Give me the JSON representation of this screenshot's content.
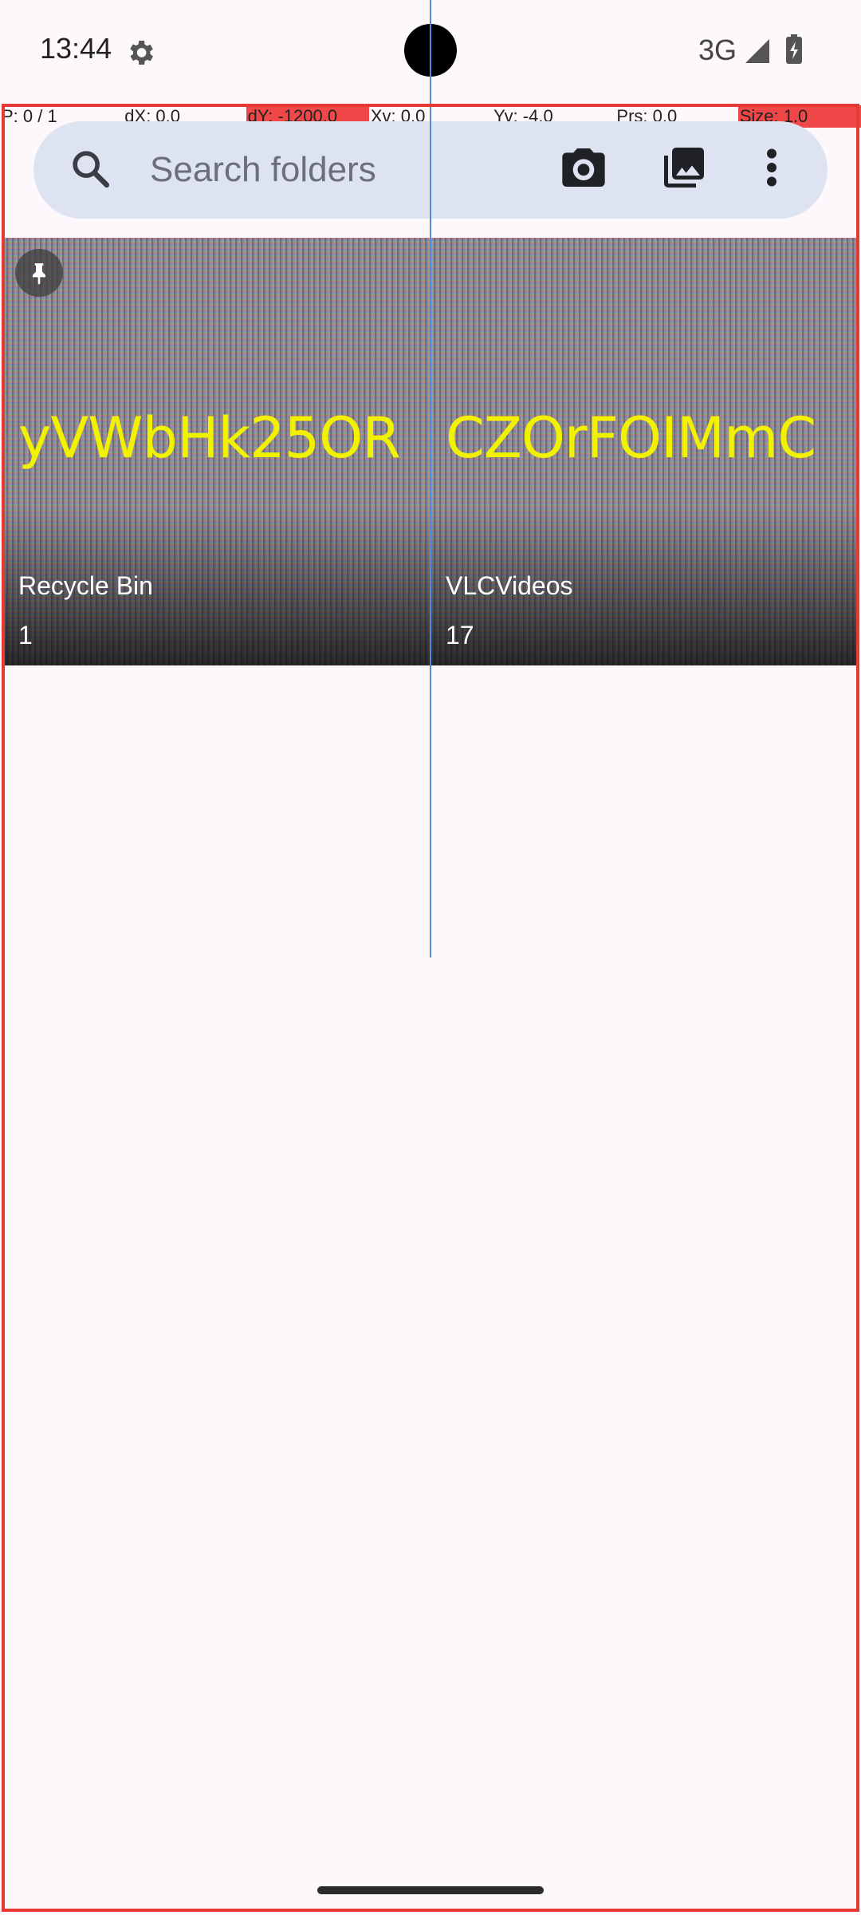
{
  "status_bar": {
    "time": "13:44",
    "network": "3G",
    "icons": [
      "settings-gear-icon",
      "signal-icon",
      "battery-charging-icon"
    ]
  },
  "debug_overlay": {
    "pointer": "P: 0 / 1",
    "dx": "dX: 0.0",
    "dy": "dY: -1200.0",
    "xv": "Xv: 0.0",
    "yv": "Yv: -4.0",
    "prs": "Prs: 0.0",
    "size": "Size: 1.0",
    "highlight_color": "#f04848",
    "frame_color": "#e53935"
  },
  "search": {
    "placeholder": "Search folders",
    "value": "",
    "icons": [
      "search-icon",
      "camera-icon",
      "gallery-icon",
      "more-vert-icon"
    ]
  },
  "folders": [
    {
      "name": "Recycle Bin",
      "count": "1",
      "thumb_text": "yVWbHk25OR",
      "pinned": true
    },
    {
      "name": "VLCVideos",
      "count": "17",
      "thumb_text": "CZOrFOIMmC",
      "pinned": false
    }
  ],
  "colors": {
    "background": "#fcf8fb",
    "search_bar": "#dde3f1",
    "thumb_text": "#f2f200"
  }
}
